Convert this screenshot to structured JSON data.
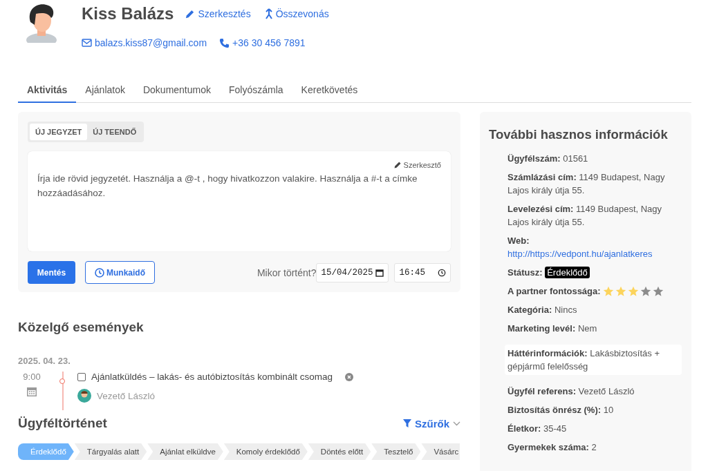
{
  "profile": {
    "name": "Kiss Balázs",
    "actions": [
      {
        "kind": "edit",
        "label": "Szerkesztés"
      },
      {
        "kind": "merge",
        "label": "Összevonás"
      }
    ],
    "contacts": [
      {
        "kind": "email",
        "label": "balazs.kiss87@gmail.com"
      },
      {
        "kind": "phone",
        "label": "+36 30 456 7891"
      }
    ]
  },
  "tabs": [
    {
      "label": "Aktivitás",
      "selected": true
    },
    {
      "label": "Ajánlatok",
      "selected": false
    },
    {
      "label": "Dokumentumok",
      "selected": false
    },
    {
      "label": "Folyószámla",
      "selected": false
    },
    {
      "label": "Keretkövetés",
      "selected": false
    }
  ],
  "composer": {
    "modes": [
      {
        "label": "ÚJ JEGYZET",
        "selected": true
      },
      {
        "label": "ÚJ TEENDŐ",
        "selected": false
      }
    ],
    "editor_link": "Szerkesztő",
    "placeholder": "Írja ide rövid jegyzetét. Használja a @-t , hogy hivatkozzon valakire. Használja a #-t a címke hozzáadásához.",
    "save_button": "Mentés",
    "worktime_button": "Munkaidő",
    "when_label": "Mikor történt?",
    "date": "15/04/2025",
    "time": "16:45"
  },
  "upcoming": {
    "title": "Közelgő események",
    "date": "2025. 04. 23.",
    "events": [
      {
        "time": "9:00",
        "title": "Ajánlatküldés – lakás- és autóbiztosítás kombinált csomag",
        "checked": false,
        "assignee": "Vezető László"
      }
    ]
  },
  "history": {
    "title": "Ügyféltörténet",
    "filter": "Szűrők",
    "stages": [
      {
        "label": "Érdeklődő",
        "selected": true
      },
      {
        "label": "Tárgyalás alatt",
        "selected": false
      },
      {
        "label": "Ajánlat elküldve",
        "selected": false
      },
      {
        "label": "Komoly érdeklődő",
        "selected": false
      },
      {
        "label": "Döntés előtt",
        "selected": false
      },
      {
        "label": "Tesztelő",
        "selected": false
      },
      {
        "label": "Vásárc",
        "selected": false
      }
    ]
  },
  "info": {
    "title": "További hasznos információk",
    "items": [
      {
        "kind": "text",
        "label": "Ügyfélszám:",
        "value": "01561"
      },
      {
        "kind": "text",
        "label": "Számlázási cím:",
        "value": "1149 Budapest, Nagy Lajos király útja 55."
      },
      {
        "kind": "text",
        "label": "Levelezési cím:",
        "value": "1149 Budapest, Nagy Lajos király útja 55."
      },
      {
        "kind": "link",
        "label": "Web:",
        "value": "http://https://vedpont.hu/ajanlatkeres"
      },
      {
        "kind": "status",
        "label": "Státusz:",
        "value": "Érdeklődő"
      },
      {
        "kind": "stars",
        "label": "A partner fontossága:",
        "stars": 3
      },
      {
        "kind": "text",
        "label": "Kategória:",
        "value": "Nincs"
      },
      {
        "kind": "text",
        "label": "Marketing levél:",
        "value": "Nem"
      },
      {
        "kind": "boxed",
        "label": "Háttérinformációk:",
        "value": "Lakásbiztosítás + gépjármű felelősség"
      },
      {
        "kind": "text",
        "label": "Ügyfél referens:",
        "value": "Vezető László"
      },
      {
        "kind": "text",
        "label": "Biztosítás önrész (%):",
        "value": "10"
      },
      {
        "kind": "text",
        "label": "Életkor:",
        "value": "35-45"
      },
      {
        "kind": "text",
        "label": "Gyermekek száma:",
        "value": "2"
      }
    ]
  }
}
